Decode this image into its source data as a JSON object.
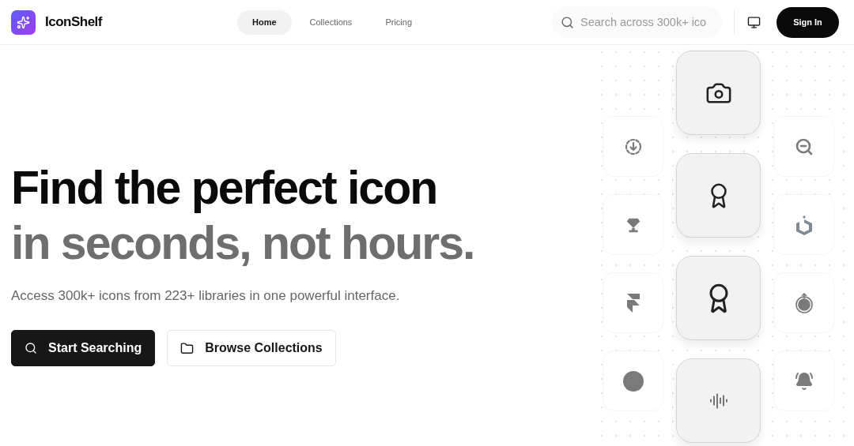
{
  "brand": {
    "name": "IconShelf"
  },
  "nav": [
    {
      "label": "Home",
      "selected": true
    },
    {
      "label": "Collections",
      "selected": false
    },
    {
      "label": "Pricing",
      "selected": false
    }
  ],
  "search": {
    "placeholder": "Search across 300k+ ico"
  },
  "sign_in": {
    "label": "Sign In"
  },
  "hero": {
    "headline": "Find the perfect icon",
    "headline_muted": "in seconds, not hours.",
    "subtitle": "Access 300k+ icons from 223+ libraries in one powerful interface.",
    "buttons": [
      {
        "kind": "primary",
        "label": "Start Searching"
      },
      {
        "kind": "secondary",
        "label": "Browse Collections"
      }
    ]
  }
}
